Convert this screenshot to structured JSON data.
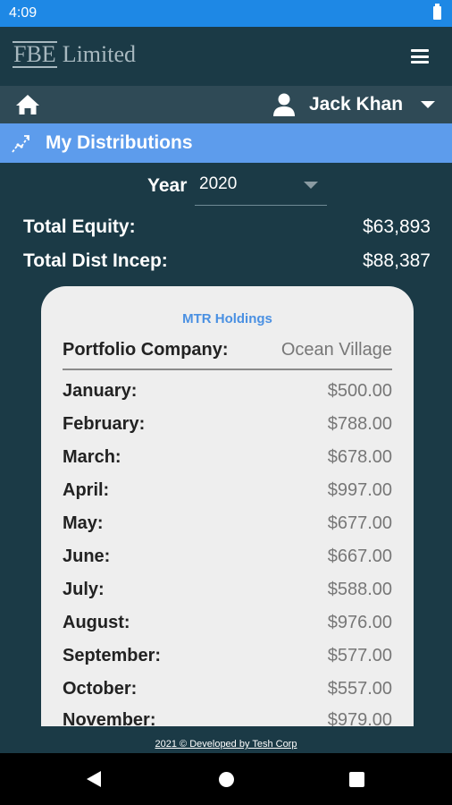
{
  "status_bar": {
    "time": "4:09"
  },
  "app_bar": {
    "logo_primary": "FBE",
    "logo_secondary": "Limited"
  },
  "user_bar": {
    "user_name": "Jack Khan"
  },
  "section": {
    "title": "My Distributions"
  },
  "filter": {
    "year_label": "Year",
    "year_value": "2020"
  },
  "summary": {
    "total_equity_label": "Total Equity:",
    "total_equity_value": "$63,893",
    "total_dist_label": "Total Dist Incep:",
    "total_dist_value": "$88,387"
  },
  "card": {
    "holding_name": "MTR Holdings",
    "portfolio_label": "Portfolio Company:",
    "portfolio_value": "Ocean Village",
    "months": [
      {
        "month": "January:",
        "amount": "$500.00"
      },
      {
        "month": "February:",
        "amount": "$788.00"
      },
      {
        "month": "March:",
        "amount": "$678.00"
      },
      {
        "month": "April:",
        "amount": "$997.00"
      },
      {
        "month": "May:",
        "amount": "$677.00"
      },
      {
        "month": "June:",
        "amount": "$667.00"
      },
      {
        "month": "July:",
        "amount": "$588.00"
      },
      {
        "month": "August:",
        "amount": "$976.00"
      },
      {
        "month": "September:",
        "amount": "$577.00"
      },
      {
        "month": "October:",
        "amount": "$557.00"
      },
      {
        "month": "November:",
        "amount": "$979.00"
      }
    ]
  },
  "footer": {
    "text": "2021 © Developed by Tesh Corp"
  },
  "icons": {
    "home": "home-icon",
    "user": "person-icon",
    "section": "distribution-icon",
    "menu": "hamburger-icon",
    "battery": "battery-icon"
  },
  "colors": {
    "background": "#1b3a46",
    "status_bar": "#1e88e5",
    "section_bar": "#5d9cec",
    "card": "#eeeeee",
    "accent": "#4a90e2"
  }
}
